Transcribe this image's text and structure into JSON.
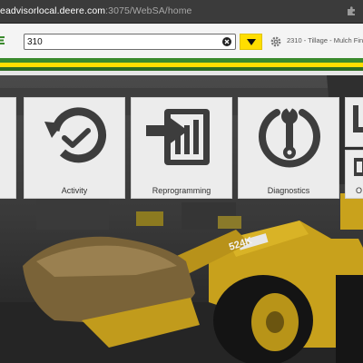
{
  "browser": {
    "url_host": "eadvisorlocal.deere.com",
    "url_path": ":3075/WebSA/home",
    "extension_icon": "puzzle-icon"
  },
  "header": {
    "search_value": "310",
    "clear_icon": "clear-icon",
    "dropdown_icon": "caret-down-icon",
    "machine_icon": "gear-icon",
    "machine_label": "2310 - Tillage - Mulch Fin"
  },
  "tiles": [
    {
      "label": "",
      "icon": "partial-tile"
    },
    {
      "label": "Activity",
      "icon": "history-check-icon"
    },
    {
      "label": "Reprogramming",
      "icon": "reprogram-icon"
    },
    {
      "label": "Diagnostics",
      "icon": "wrench-power-icon"
    },
    {
      "label": "O",
      "icon": "partial-tile"
    }
  ],
  "photo": {
    "machine_badge": "524K"
  },
  "colors": {
    "green": "#3a8a2d",
    "yellow": "#ffde00",
    "dark_green": "#2d6c23",
    "tile_bg": "#ececec",
    "icon_gray": "#3d3d3d"
  }
}
